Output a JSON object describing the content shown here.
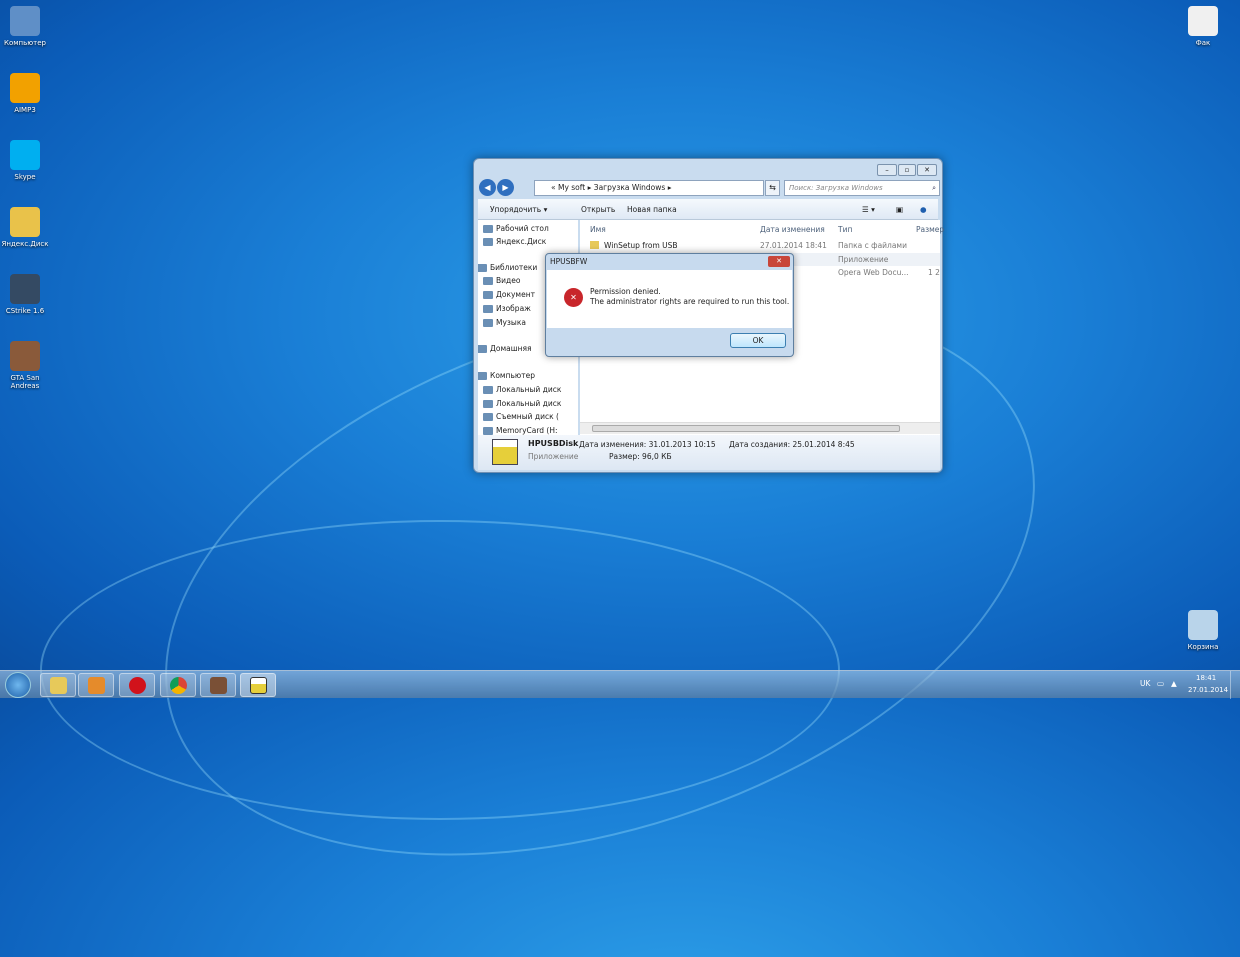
{
  "desktop": {
    "icons": [
      {
        "label": "Компьютер",
        "color": "#5f8fc7"
      },
      {
        "label": "AIMP3",
        "color": "#f2a100"
      },
      {
        "label": "Skype",
        "color": "#00aff0"
      },
      {
        "label": "Яндекс.Диск",
        "color": "#e9c24a"
      },
      {
        "label": "CStrike 1.6",
        "color": "#344a63"
      },
      {
        "label": "GTA San Andreas",
        "color": "#8a5a3a"
      }
    ],
    "right_icons": [
      {
        "label": "Фак",
        "color": "#f0f0f0"
      },
      {
        "label": "Корзина",
        "color": "#b9d4ea"
      }
    ]
  },
  "explorer": {
    "breadcrumb": [
      "«",
      "My soft",
      "Загрузка Windows"
    ],
    "search_placeholder": "Поиск: Загрузка Windows",
    "toolbar": {
      "organize": "Упорядочить ▾",
      "open": "Открыть",
      "new_folder": "Новая папка"
    },
    "nav": [
      "Рабочий стол",
      "Яндекс.Диск",
      "Библиотеки",
      "Видео",
      "Документ",
      "Изображ",
      "Музыка",
      "Домашняя",
      "Компьютер",
      "Локальный диск",
      "Локальный диск",
      "Съемный диск (",
      "MemoryCard (H:"
    ],
    "columns": [
      "Имя",
      "Дата изменения",
      "Тип",
      "Размер"
    ],
    "rows": [
      {
        "name": "WinSetup from USB",
        "date": "27.01.2014 18:41",
        "type": "Папка с файлами",
        "size": ""
      },
      {
        "name": "",
        "date": "10:15",
        "type": "Приложение",
        "size": ""
      },
      {
        "name": "",
        "date": "11:26",
        "type": "Opera Web Docu...",
        "size": "1 2"
      }
    ],
    "details": {
      "name": "HPUSBDisk",
      "type": "Приложение",
      "modified": "Дата изменения: 31.01.2013 10:15",
      "created": "Дата создания: 25.01.2014 8:45",
      "size": "Размер: 96,0 КБ"
    }
  },
  "dialog": {
    "title": "HPUSBFW",
    "line1": "Permission denied.",
    "line2": "The administrator rights are required to run this tool.",
    "ok": "OK"
  },
  "tray": {
    "lang": "UK",
    "time": "18:41",
    "date": "27.01.2014"
  }
}
